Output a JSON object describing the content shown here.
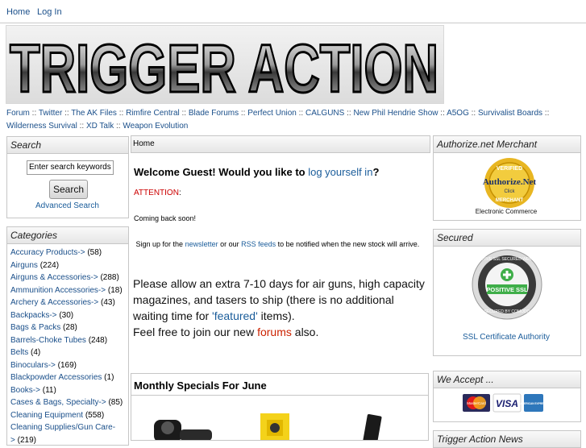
{
  "topnav": {
    "home": "Home",
    "login": "Log In"
  },
  "banner": {
    "title": "TRIGGER ACTION"
  },
  "links": [
    "Forum",
    "Twitter",
    "The AK Files",
    "Rimfire Central",
    "Blade Forums",
    "Perfect Union",
    "CALGUNS",
    "New Phil Hendrie Show",
    "A5OG",
    "Survivalist Boards",
    "Wilderness Survival",
    "XD Talk",
    "Weapon Evolution"
  ],
  "search": {
    "title": "Search",
    "placeholder": "Enter search keywords",
    "button": "Search",
    "advanced": "Advanced Search"
  },
  "categories": {
    "title": "Categories",
    "items": [
      {
        "name": "Accuracy Products->",
        "count": "(58)"
      },
      {
        "name": "Airguns",
        "count": "(224)"
      },
      {
        "name": "Airguns & Accessories->",
        "count": "(288)"
      },
      {
        "name": "Ammunition Accessories->",
        "count": "(18)"
      },
      {
        "name": "Archery & Accessories->",
        "count": "(43)"
      },
      {
        "name": "Backpacks->",
        "count": "(30)"
      },
      {
        "name": "Bags & Packs",
        "count": "(28)"
      },
      {
        "name": "Barrels-Choke Tubes",
        "count": "(248)"
      },
      {
        "name": "Belts",
        "count": "(4)"
      },
      {
        "name": "Binoculars->",
        "count": "(169)"
      },
      {
        "name": "Blackpowder Accessories",
        "count": "(1)"
      },
      {
        "name": "Books->",
        "count": "(11)"
      },
      {
        "name": "Cases & Bags, Specialty->",
        "count": "(85)"
      },
      {
        "name": "Cleaning Equipment",
        "count": "(558)"
      },
      {
        "name": "Cleaning Supplies/Gun Care-",
        "count": ""
      },
      {
        "name": ">",
        "count": "(219)"
      }
    ]
  },
  "breadcrumb": "Home",
  "main": {
    "welcome_prefix": "Welcome Guest! Would you like to ",
    "welcome_link": "log yourself in",
    "welcome_suffix": "?",
    "attention": "ATTENTION",
    "attention_colon": ":",
    "coming_soon": "Coming back soon!",
    "signup_1": "Sign up for the ",
    "signup_newsletter": "newsletter",
    "signup_2": " or our ",
    "signup_rss": "RSS feeds",
    "signup_3": " to be notified when the new stock will arrive.",
    "allow_1": "Please allow an extra 7-10 days for air guns, high capacity magazines, and tasers to ship (there is no additional waiting time for ",
    "allow_featured": "'featured'",
    "allow_2": " items).",
    "allow_3": "Feel free to join our new ",
    "allow_forums": "forums",
    "allow_4": " also.",
    "specials_title": "Monthly Specials For June"
  },
  "right": {
    "authorize_title": "Authorize.net Merchant",
    "authorize_logo_top": "VERIFIED",
    "authorize_logo_main": "Authorize.Net",
    "authorize_logo_click": "Click",
    "authorize_logo_bottom": "MERCHANT",
    "electronic_commerce": "Electronic Commerce",
    "secured_title": "Secured",
    "ssl_ring": "POSITIVE SSL SECURED WEBSITE",
    "ssl_main": "POSITIVE SSL",
    "ssl_bottom": "SECURED BY COMODO",
    "ssl_caption": "SSL Certificate Authority",
    "accept_title": "We Accept ...",
    "card_visa": "VISA",
    "card_mc": "MasterCard",
    "card_amex": "AMERICAN EXPRESS",
    "next_title": "Trigger Action News"
  }
}
